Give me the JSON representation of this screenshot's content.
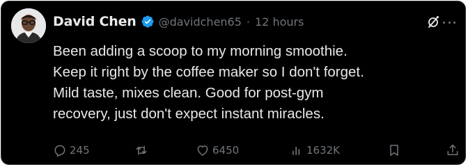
{
  "user": {
    "display_name": "David Chen",
    "handle": "@davidchen65",
    "separator": "·",
    "time": "12 hours",
    "verified": true
  },
  "tweet": {
    "lines": [
      "Been adding a scoop to my morning smoothie.",
      "Keep it right by the coffee maker so I don't forget.",
      "Mild taste, mixes clean. Good for post-gym",
      "recovery, just don't expect instant miracles."
    ]
  },
  "actions": {
    "replies": "245",
    "reposts": "",
    "likes": "6450",
    "views": "1632K"
  },
  "icons": {
    "verified": "verified-badge-icon",
    "grok": "grok-icon",
    "more": "more-options-icon",
    "reply": "reply-icon",
    "repost": "repost-icon",
    "like": "heart-icon",
    "views": "views-bars-icon",
    "bookmark": "bookmark-icon",
    "share": "share-icon"
  },
  "colors": {
    "background": "#000000",
    "text": "#e7e9ea",
    "muted": "#71767b",
    "verified": "#1d9bf0",
    "border": "#2f3336"
  }
}
